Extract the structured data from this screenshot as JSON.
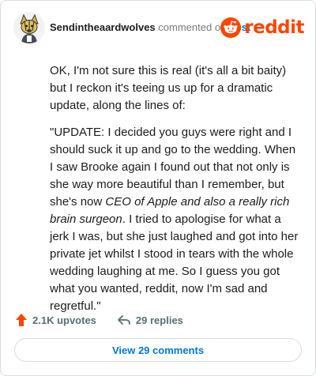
{
  "header": {
    "username": "Sendintheaardwolves",
    "action": "commented on",
    "post_link": "post",
    "brand": "reddit"
  },
  "comment": {
    "intro": "OK, I'm not sure this is real (it's all a bit baity) but I reckon it's teeing us up for a dramatic update, along the lines of:",
    "quote_start": "\"UPDATE: I decided you guys were right and I should suck it up and go to the wedding. When I saw Brooke again I found out that not only is she way more beautiful than I remember, but she's now ",
    "quote_italic": "CEO of Apple and also a really rich brain surgeon",
    "quote_end": ". I tried to apologise for what a jerk I was, but she just laughed and got into her private jet whilst I stood in tears with the whole wedding laughing at me. So I guess you got what you wanted, reddit, now I'm sad and regretful.\""
  },
  "footer": {
    "upvotes": "2.1K upvotes",
    "replies": "29 replies",
    "view_comments": "View 29 comments"
  },
  "colors": {
    "brand": "#ff4500",
    "link": "#0079d3",
    "muted": "#576f76"
  },
  "icons": {
    "avatar": "aardwolf-avatar",
    "brand": "reddit-snoo-icon",
    "upvote": "upvote-arrow-icon",
    "reply": "reply-arrow-icon"
  }
}
